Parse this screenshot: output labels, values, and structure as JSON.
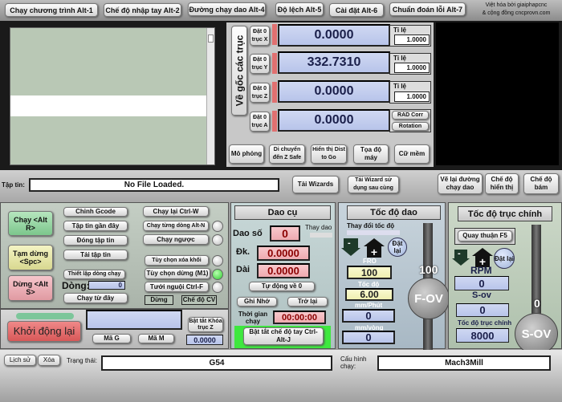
{
  "tabs": [
    "Chạy chương trình  Alt-1",
    "Chế độ nhập tay Alt-2",
    "Đường chạy dao Alt-4",
    "Độ lệch Alt-5",
    "Cài đặt Alt-6",
    "Chuẩn đoán lỗi Alt-7"
  ],
  "credit": [
    "Việt hóa bởi giaiphapcnc",
    "& cộng đồng cncprovn.com"
  ],
  "dro": {
    "ref_all": "Về gốc các trục",
    "axes": [
      {
        "zero": "Đặt 0 trục X",
        "value": "0.0000",
        "scale_label": "Tỉ lệ",
        "scale": "1.0000"
      },
      {
        "zero": "Đặt 0 trục Y",
        "value": "332.7310",
        "scale_label": "Tỉ lệ",
        "scale": "1.0000"
      },
      {
        "zero": "Đặt 0 trục Z",
        "value": "0.0000",
        "scale_label": "Tỉ lệ",
        "scale": "1.0000"
      },
      {
        "zero": "Đặt 0 trục A",
        "value": "0.0000"
      }
    ],
    "rad_corr": "RAD Corr",
    "rotation": "Rotation",
    "buttons": [
      "Mô phỏng",
      "Di chuyển đến Z Safe",
      "Hiển thị Dist to Go",
      "Tọa độ máy",
      "Cữ mềm"
    ]
  },
  "file": {
    "label": "Tập tin:",
    "value": "No File Loaded.",
    "wizards": "Tải Wizards",
    "last_wizard": "Tải Wizard sử dụng sau cùng"
  },
  "right_buttons": [
    "Vẽ lại đường chạy dao",
    "Chế độ hiển thị",
    "Chế độ bám"
  ],
  "control": {
    "run": "Chạy <Alt R>",
    "pause": "Tạm dừng <Spc>",
    "stop": "Dừng <Alt S>",
    "mid": [
      "Chỉnh Gcode",
      "Tập tin gần đây",
      "Đóng tập tin",
      "Tải tập tin"
    ],
    "set_line": "Thiết lập dòng chạy",
    "line_label": "Dòng:",
    "line_value": "0",
    "run_from": "Chạy từ đây",
    "right": [
      "Chạy lại Ctrl-W",
      "Chạy từng dòng Alt-N",
      "Chạy ngược",
      "Tùy chọn xóa khối",
      "Tùy chọn dừng (M1)",
      "Tưới nguội Ctrl-F"
    ],
    "led_on": [
      false,
      false,
      false,
      true,
      false
    ],
    "dung": "Dừng",
    "cv": "Chế độ CV",
    "reset": "Khởi động lại",
    "gcode": "Mã G",
    "mcode": "Mã M",
    "z_inhibit": "Bật tắt Khóa trục Z",
    "z_value": "0.0000"
  },
  "tool": {
    "title": "Dao cụ",
    "tool_no_label": "Dao số",
    "tool_no": "0",
    "change": "Thay dao",
    "dia_label": "Đk.",
    "dia": "0.0000",
    "len_label": "Dài",
    "len": "0.0000",
    "auto_zero": "Tự động về 0",
    "remember": "Ghi Nhớ",
    "return": "Trở lại",
    "time_label": "Thời gian chạy",
    "time": "00:00:00",
    "jog": "Bật tắt chế độ tay Ctrl-Alt-J"
  },
  "feed": {
    "title": "Tốc độ dao",
    "change": "Thay đổi tốc độ",
    "reset": "Đặt lại",
    "fro_label": "FRO",
    "fro": "100",
    "rate_label": "Tốc độ",
    "rate": "6.00",
    "mmmin_label": "mm/Phút",
    "mmmin": "0",
    "mmrev_label": "mm/vòng",
    "mmrev": "0",
    "slider": "100",
    "fov": "F-OV"
  },
  "spindle": {
    "title": "Tốc độ trục chính",
    "cw": "Quay thuận F5",
    "reset": "Đặt lại",
    "rpm_label": "RPM",
    "rpm": "0",
    "sov_label": "S-ov",
    "sov": "0",
    "speed_label": "Tốc độ trục chính",
    "speed": "8000",
    "slider": "0",
    "sov_btn": "S-OV"
  },
  "status": {
    "history": "Lịch sử",
    "clear": "Xóa",
    "label": "Trạng thái:",
    "value": "G54",
    "profile_label": "Cấu hình chạy:",
    "profile": "Mach3Mill"
  },
  "colors": {
    "run": "#8fd19e",
    "pause": "#e6e6a0",
    "stop": "#e8a0a8",
    "reset": "#e86060",
    "led_on": "#2ecc2e"
  }
}
